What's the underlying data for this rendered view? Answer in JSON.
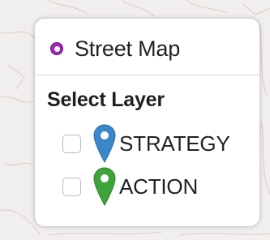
{
  "basemap": {
    "label": "Street Map",
    "selected": true,
    "radio_color": "#9c27b0",
    "icon": "radio-selected-icon"
  },
  "layers": {
    "title": "Select Layer",
    "items": [
      {
        "label": "STRATEGY",
        "checked": false,
        "marker_color": "#3b87c9",
        "icon": "map-marker-icon"
      },
      {
        "label": "ACTION",
        "checked": false,
        "marker_color": "#3ea338",
        "icon": "map-marker-icon"
      }
    ]
  },
  "colors": {
    "map_background": "#f1eeee",
    "map_roads": "#ddc6c6",
    "panel_background": "#ffffff"
  }
}
